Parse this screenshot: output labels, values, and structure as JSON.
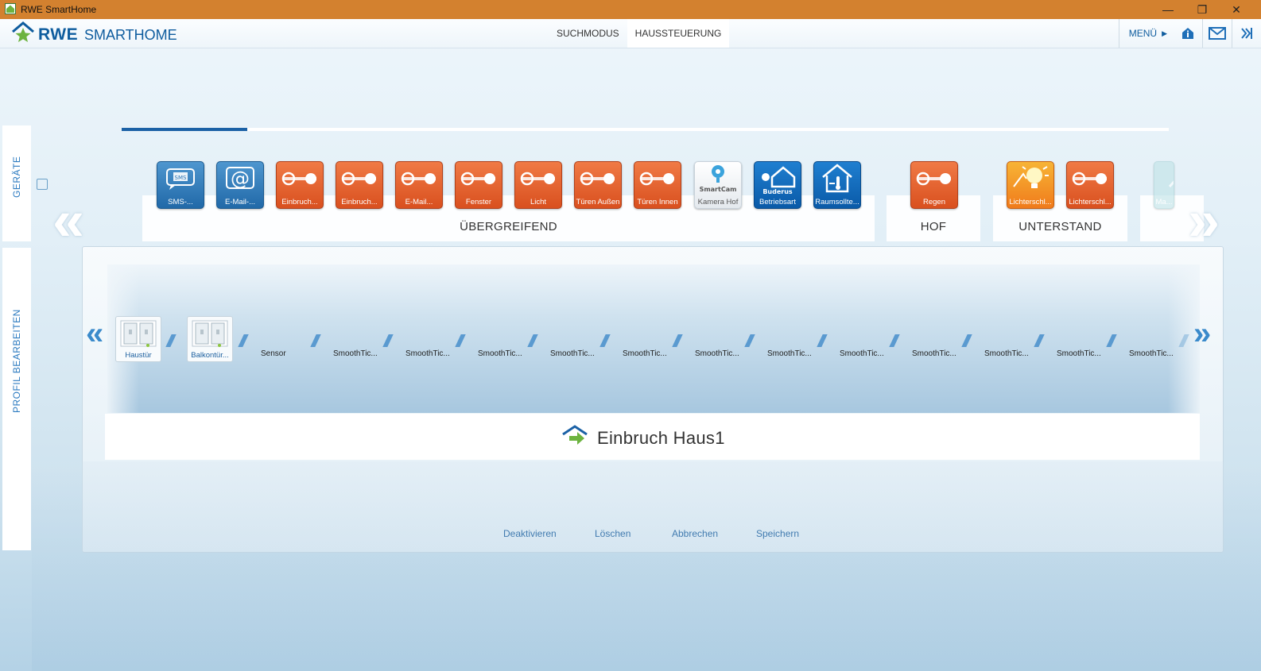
{
  "window": {
    "title": "RWE SmartHome",
    "minimize": "—",
    "maximize": "❐",
    "close": "✕"
  },
  "header": {
    "logo_brand": "RWE",
    "logo_product": "SMARTHOME",
    "tabs": [
      {
        "label": "SUCHMODUS",
        "active": false
      },
      {
        "label": "HAUSSTEUERUNG",
        "active": true
      }
    ],
    "menu_label": "MENÜ",
    "icons": [
      "home-info-icon",
      "mail-icon",
      "collapse-icon"
    ]
  },
  "sidebar": {
    "tab_devices": "GERÄTE",
    "tab_profile": "PROFIL BEARBEITEN"
  },
  "progress": {
    "fraction": 0.12
  },
  "groups": [
    {
      "label": "ÜBERGREIFEND"
    },
    {
      "label": "HOF"
    },
    {
      "label": "UNTERSTAND"
    }
  ],
  "tiles": [
    {
      "label": "SMS-...",
      "style": "blue",
      "icon": "sms-icon"
    },
    {
      "label": "E-Mail-...",
      "style": "blue",
      "icon": "at-mail-icon"
    },
    {
      "label": "Einbruch...",
      "style": "red",
      "icon": "toggle-icon"
    },
    {
      "label": "Einbruch...",
      "style": "red",
      "icon": "toggle-icon"
    },
    {
      "label": "E-Mail...",
      "style": "red",
      "icon": "toggle-icon"
    },
    {
      "label": "Fenster",
      "style": "red",
      "icon": "toggle-icon"
    },
    {
      "label": "Licht",
      "style": "red",
      "icon": "toggle-icon"
    },
    {
      "label": "Türen Außen",
      "style": "red",
      "icon": "toggle-icon"
    },
    {
      "label": "Türen Innen",
      "style": "red",
      "icon": "toggle-icon"
    },
    {
      "label": "Kamera Hof",
      "style": "white",
      "icon": "smartcam-icon",
      "logo_text": "SmartCam"
    },
    {
      "label": "Betriebsart",
      "style": "dblue",
      "icon": "buderus-house-icon",
      "logo_text": "Buderus"
    },
    {
      "label": "Raumsollte...",
      "style": "dblue",
      "icon": "thermostat-house-icon"
    },
    {
      "label": "Regen",
      "style": "red",
      "icon": "toggle-icon"
    },
    {
      "label": "Lichterschl...",
      "style": "orange",
      "icon": "lightbulb-icon"
    },
    {
      "label": "Lichterschl...",
      "style": "red",
      "icon": "toggle-icon"
    },
    {
      "label": "Ma...",
      "style": "faint",
      "icon": "faded-icon"
    }
  ],
  "profile": {
    "devices": [
      {
        "label": "Haustür"
      },
      {
        "label": "Balkontür..."
      }
    ],
    "slots": [
      "Sensor",
      "SmoothTic...",
      "SmoothTic...",
      "SmoothTic...",
      "SmoothTic...",
      "SmoothTic...",
      "SmoothTic...",
      "SmoothTic...",
      "SmoothTic...",
      "SmoothTic...",
      "SmoothTic...",
      "SmoothTic...",
      "SmoothTic..."
    ],
    "name": "Einbruch Haus1",
    "actions": {
      "deactivate": "Deaktivieren",
      "delete": "Löschen",
      "cancel": "Abbrechen",
      "save": "Speichern"
    }
  },
  "colors": {
    "titlebar": "#d3812f",
    "brand_blue": "#0e5c9e",
    "tile_red": "#e35f2c",
    "tile_blue": "#2a74b3",
    "accent_green": "#6cb33f"
  }
}
